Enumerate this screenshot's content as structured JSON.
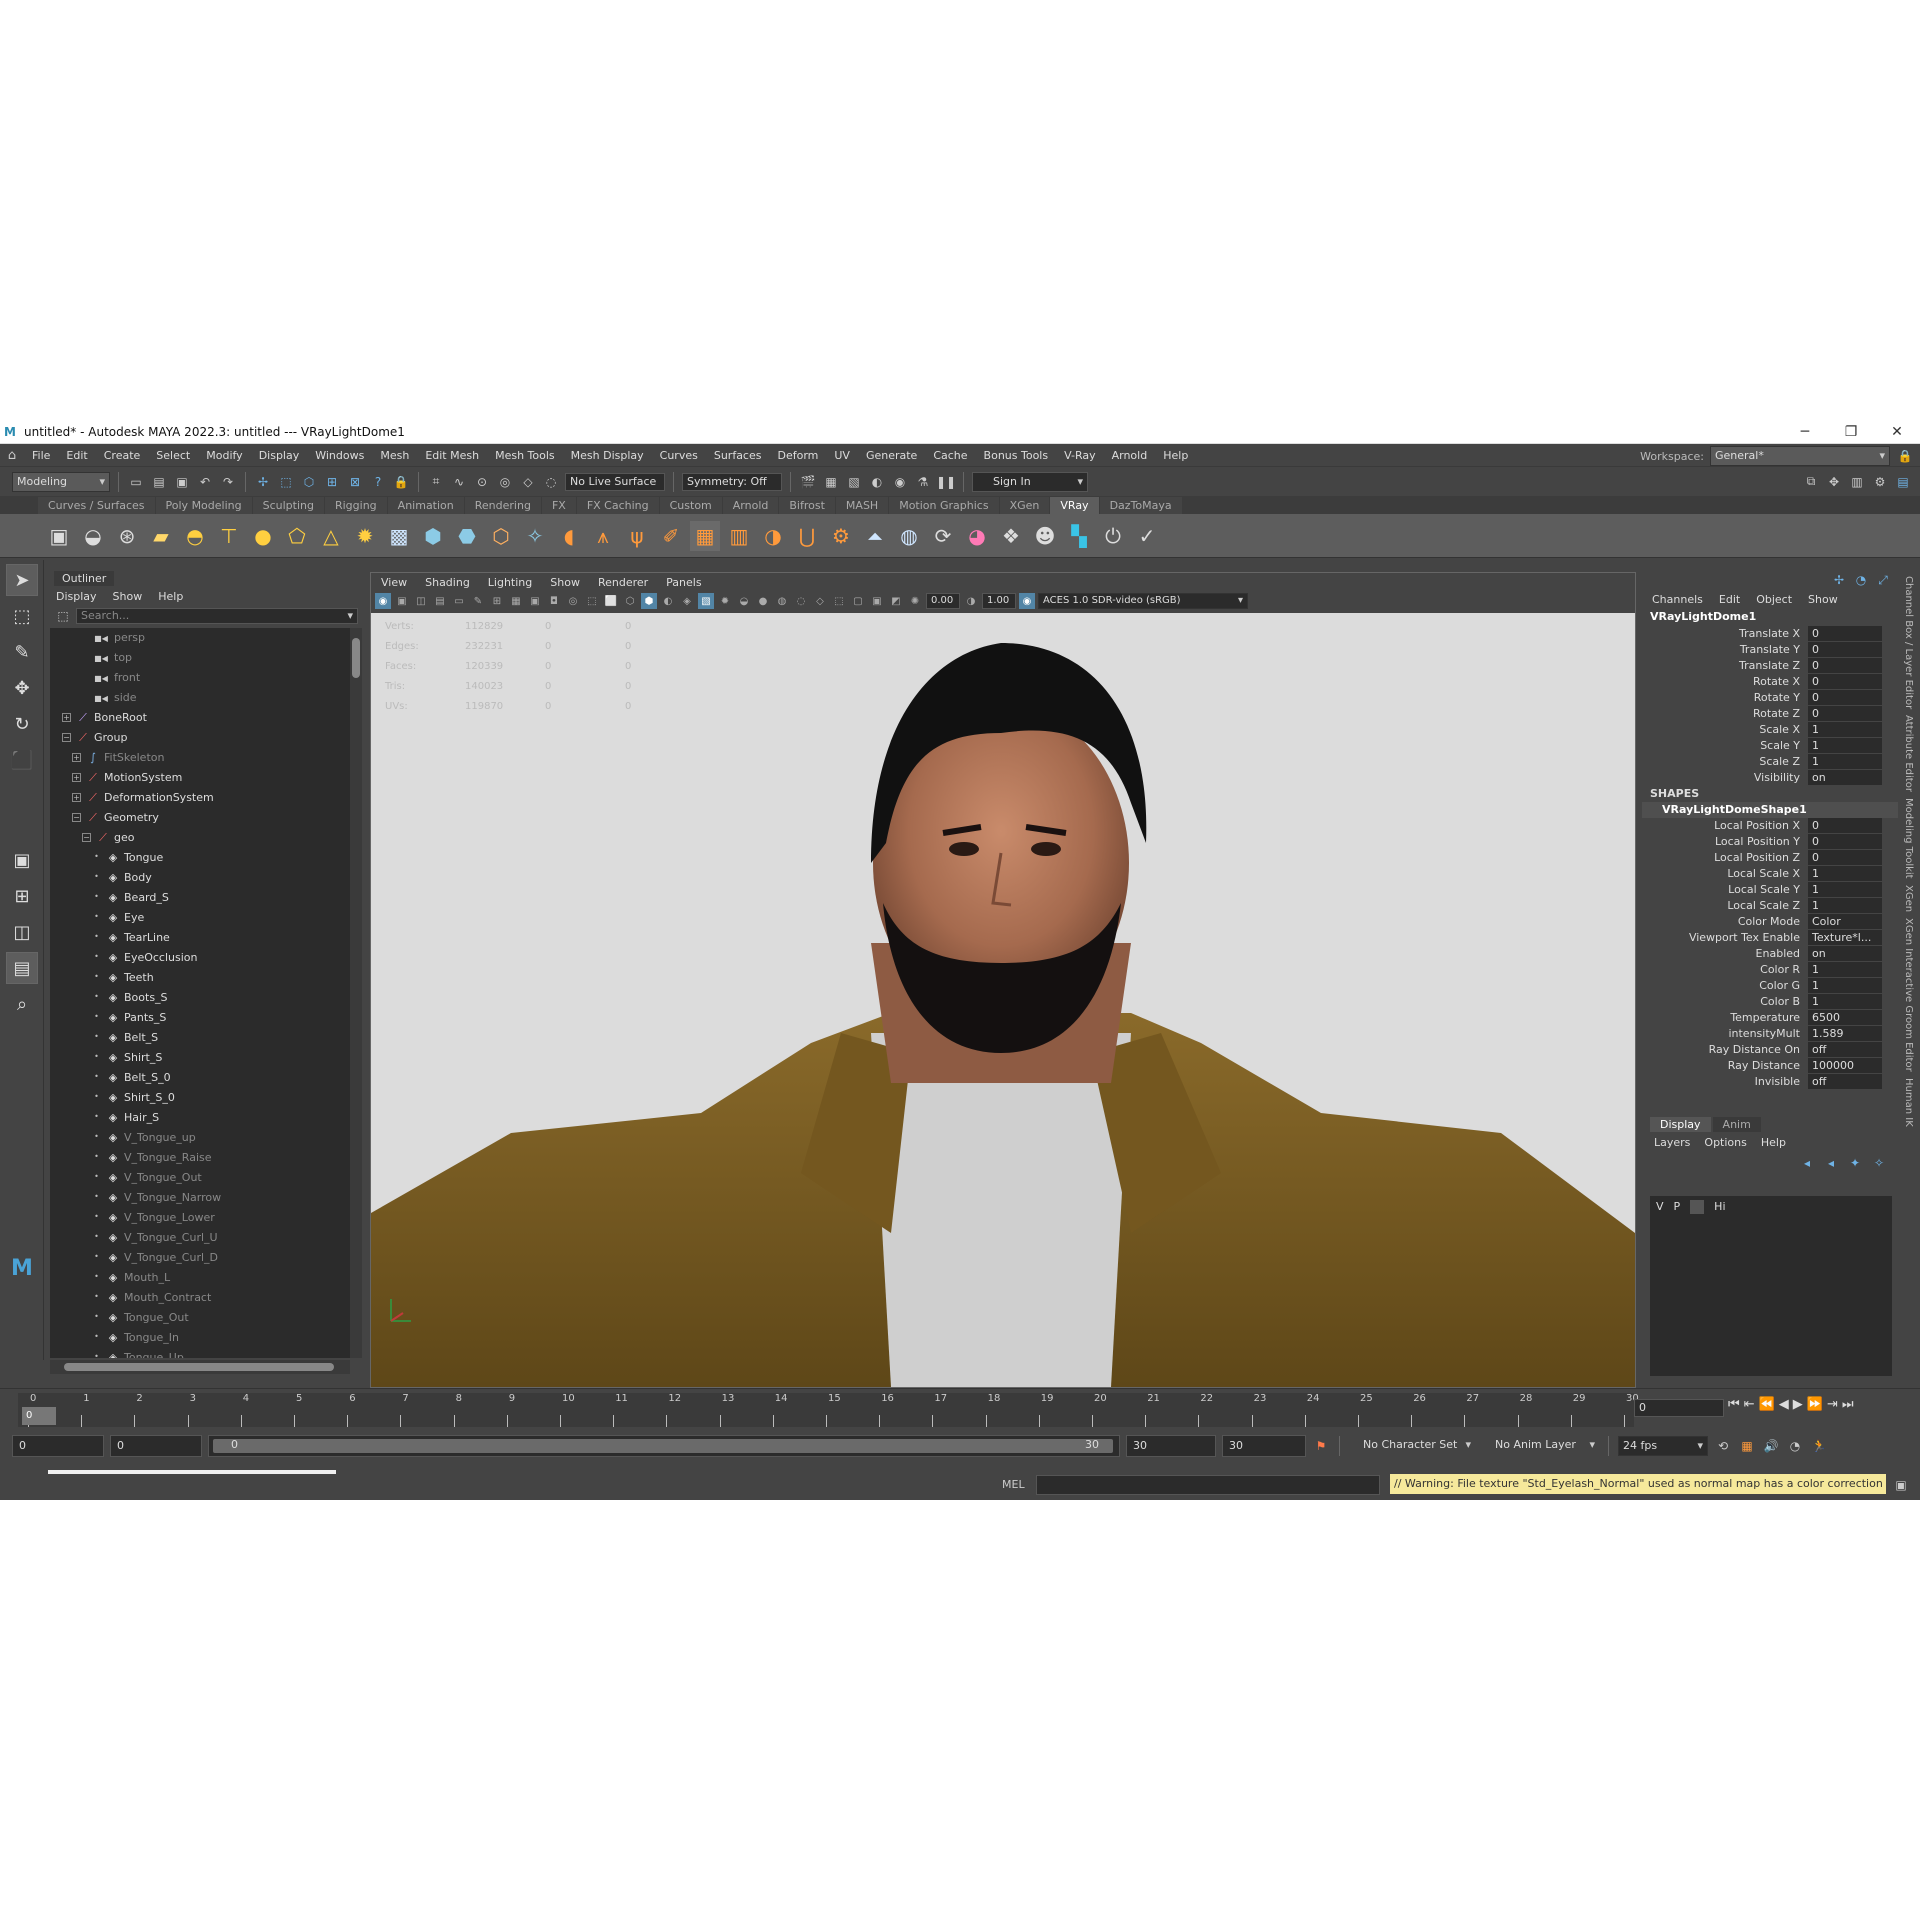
{
  "window": {
    "title": "untitled* - Autodesk MAYA 2022.3: untitled   ---   VRayLightDome1",
    "minimize": "─",
    "restore": "❐",
    "close": "✕"
  },
  "menubar": {
    "items": [
      "File",
      "Edit",
      "Create",
      "Select",
      "Modify",
      "Display",
      "Windows",
      "Mesh",
      "Edit Mesh",
      "Mesh Tools",
      "Mesh Display",
      "Curves",
      "Surfaces",
      "Deform",
      "UV",
      "Generate",
      "Cache",
      "Bonus Tools",
      "V-Ray",
      "Arnold",
      "Help"
    ],
    "workspace_label": "Workspace:",
    "workspace_value": "General*"
  },
  "statusline": {
    "mode": "Modeling",
    "live_surface": "No Live Surface",
    "symmetry": "Symmetry: Off",
    "sign_in": "Sign In"
  },
  "shelf": {
    "tabs": [
      "Curves / Surfaces",
      "Poly Modeling",
      "Sculpting",
      "Rigging",
      "Animation",
      "Rendering",
      "FX",
      "FX Caching",
      "Custom",
      "Arnold",
      "Bifrost",
      "MASH",
      "Motion Graphics",
      "XGen",
      "VRay",
      "DazToMaya"
    ],
    "active_tab": "VRay"
  },
  "outliner": {
    "title": "Outliner",
    "menu": [
      "Display",
      "Show",
      "Help"
    ],
    "search_placeholder": "Search...",
    "items": [
      {
        "label": "persp",
        "depth": 0,
        "dim": true,
        "icon": "camera-icon",
        "expander": ""
      },
      {
        "label": "top",
        "depth": 0,
        "dim": true,
        "icon": "camera-icon",
        "expander": ""
      },
      {
        "label": "front",
        "depth": 0,
        "dim": true,
        "icon": "camera-icon",
        "expander": ""
      },
      {
        "label": "side",
        "depth": 0,
        "dim": true,
        "icon": "camera-icon",
        "expander": ""
      },
      {
        "label": "BoneRoot",
        "depth": 0,
        "dim": false,
        "icon": "joint-icon",
        "expander": "+"
      },
      {
        "label": "Group",
        "depth": 0,
        "dim": false,
        "icon": "transform-icon",
        "expander": "−"
      },
      {
        "label": "FitSkeleton",
        "depth": 1,
        "dim": true,
        "icon": "curve-icon",
        "expander": "+"
      },
      {
        "label": "MotionSystem",
        "depth": 1,
        "dim": false,
        "icon": "transform-icon",
        "expander": "+"
      },
      {
        "label": "DeformationSystem",
        "depth": 1,
        "dim": false,
        "icon": "transform-icon",
        "expander": "+"
      },
      {
        "label": "Geometry",
        "depth": 1,
        "dim": false,
        "icon": "transform-icon",
        "expander": "−"
      },
      {
        "label": "geo",
        "depth": 2,
        "dim": false,
        "icon": "transform-icon",
        "expander": "−"
      },
      {
        "label": "Tongue",
        "depth": 3,
        "dim": false,
        "icon": "mesh-icon",
        "expander": "•"
      },
      {
        "label": "Body",
        "depth": 3,
        "dim": false,
        "icon": "mesh-icon",
        "expander": "•"
      },
      {
        "label": "Beard_S",
        "depth": 3,
        "dim": false,
        "icon": "mesh-icon",
        "expander": "•"
      },
      {
        "label": "Eye",
        "depth": 3,
        "dim": false,
        "icon": "mesh-icon",
        "expander": "•"
      },
      {
        "label": "TearLine",
        "depth": 3,
        "dim": false,
        "icon": "mesh-icon",
        "expander": "•"
      },
      {
        "label": "EyeOcclusion",
        "depth": 3,
        "dim": false,
        "icon": "mesh-icon",
        "expander": "•"
      },
      {
        "label": "Teeth",
        "depth": 3,
        "dim": false,
        "icon": "mesh-icon",
        "expander": "•"
      },
      {
        "label": "Boots_S",
        "depth": 3,
        "dim": false,
        "icon": "mesh-icon",
        "expander": "•"
      },
      {
        "label": "Pants_S",
        "depth": 3,
        "dim": false,
        "icon": "mesh-icon",
        "expander": "•"
      },
      {
        "label": "Belt_S",
        "depth": 3,
        "dim": false,
        "icon": "mesh-icon",
        "expander": "•"
      },
      {
        "label": "Shirt_S",
        "depth": 3,
        "dim": false,
        "icon": "mesh-icon",
        "expander": "•"
      },
      {
        "label": "Belt_S_0",
        "depth": 3,
        "dim": false,
        "icon": "mesh-icon",
        "expander": "•"
      },
      {
        "label": "Shirt_S_0",
        "depth": 3,
        "dim": false,
        "icon": "mesh-icon",
        "expander": "•"
      },
      {
        "label": "Hair_S",
        "depth": 3,
        "dim": false,
        "icon": "mesh-icon",
        "expander": "•"
      },
      {
        "label": "V_Tongue_up",
        "depth": 3,
        "dim": true,
        "icon": "mesh-icon",
        "expander": "•"
      },
      {
        "label": "V_Tongue_Raise",
        "depth": 3,
        "dim": true,
        "icon": "mesh-icon",
        "expander": "•"
      },
      {
        "label": "V_Tongue_Out",
        "depth": 3,
        "dim": true,
        "icon": "mesh-icon",
        "expander": "•"
      },
      {
        "label": "V_Tongue_Narrow",
        "depth": 3,
        "dim": true,
        "icon": "mesh-icon",
        "expander": "•"
      },
      {
        "label": "V_Tongue_Lower",
        "depth": 3,
        "dim": true,
        "icon": "mesh-icon",
        "expander": "•"
      },
      {
        "label": "V_Tongue_Curl_U",
        "depth": 3,
        "dim": true,
        "icon": "mesh-icon",
        "expander": "•"
      },
      {
        "label": "V_Tongue_Curl_D",
        "depth": 3,
        "dim": true,
        "icon": "mesh-icon",
        "expander": "•"
      },
      {
        "label": "Mouth_L",
        "depth": 3,
        "dim": true,
        "icon": "mesh-icon",
        "expander": "•"
      },
      {
        "label": "Mouth_Contract",
        "depth": 3,
        "dim": true,
        "icon": "mesh-icon",
        "expander": "•"
      },
      {
        "label": "Tongue_Out",
        "depth": 3,
        "dim": true,
        "icon": "mesh-icon",
        "expander": "•"
      },
      {
        "label": "Tongue_In",
        "depth": 3,
        "dim": true,
        "icon": "mesh-icon",
        "expander": "•"
      },
      {
        "label": "Tongue_Up",
        "depth": 3,
        "dim": true,
        "icon": "mesh-icon",
        "expander": "•"
      }
    ]
  },
  "viewport": {
    "menu": [
      "View",
      "Shading",
      "Lighting",
      "Show",
      "Renderer",
      "Panels"
    ],
    "exposure": "0.00",
    "gamma": "1.00",
    "color_space": "ACES 1.0 SDR-video (sRGB)",
    "hud": [
      {
        "label": "Verts:",
        "v1": "112829",
        "v2": "0",
        "v3": "0"
      },
      {
        "label": "Edges:",
        "v1": "232231",
        "v2": "0",
        "v3": "0"
      },
      {
        "label": "Faces:",
        "v1": "120339",
        "v2": "0",
        "v3": "0"
      },
      {
        "label": "Tris:",
        "v1": "140023",
        "v2": "0",
        "v3": "0"
      },
      {
        "label": "UVs:",
        "v1": "119870",
        "v2": "0",
        "v3": "0"
      }
    ]
  },
  "channelbox": {
    "menu": [
      "Channels",
      "Edit",
      "Object",
      "Show"
    ],
    "object": "VRayLightDome1",
    "transform": [
      {
        "name": "Translate X",
        "value": "0"
      },
      {
        "name": "Translate Y",
        "value": "0"
      },
      {
        "name": "Translate Z",
        "value": "0"
      },
      {
        "name": "Rotate X",
        "value": "0"
      },
      {
        "name": "Rotate Y",
        "value": "0"
      },
      {
        "name": "Rotate Z",
        "value": "0"
      },
      {
        "name": "Scale X",
        "value": "1"
      },
      {
        "name": "Scale Y",
        "value": "1"
      },
      {
        "name": "Scale Z",
        "value": "1"
      },
      {
        "name": "Visibility",
        "value": "on"
      }
    ],
    "shapes_label": "SHAPES",
    "shape": "VRayLightDomeShape1",
    "shape_attrs": [
      {
        "name": "Local Position X",
        "value": "0"
      },
      {
        "name": "Local Position Y",
        "value": "0"
      },
      {
        "name": "Local Position Z",
        "value": "0"
      },
      {
        "name": "Local Scale X",
        "value": "1"
      },
      {
        "name": "Local Scale Y",
        "value": "1"
      },
      {
        "name": "Local Scale Z",
        "value": "1"
      },
      {
        "name": "Color Mode",
        "value": "Color"
      },
      {
        "name": "Viewport Tex Enable",
        "value": "Texture*l..."
      },
      {
        "name": "Enabled",
        "value": "on"
      },
      {
        "name": "Color R",
        "value": "1"
      },
      {
        "name": "Color G",
        "value": "1"
      },
      {
        "name": "Color B",
        "value": "1"
      },
      {
        "name": "Temperature",
        "value": "6500"
      },
      {
        "name": "intensityMult",
        "value": "1.589"
      },
      {
        "name": "Ray Distance On",
        "value": "off"
      },
      {
        "name": "Ray Distance",
        "value": "100000"
      },
      {
        "name": "Invisible",
        "value": "off"
      }
    ]
  },
  "layereditor": {
    "tabs": [
      "Display",
      "Anim"
    ],
    "menu": [
      "Layers",
      "Options",
      "Help"
    ],
    "row": {
      "v": "V",
      "p": "P",
      "name": "Hi"
    }
  },
  "sidetabs": [
    "Channel Box / Layer Editor",
    "Attribute Editor",
    "Modeling Toolkit",
    "XGen",
    "XGen Interactive Groom Editor",
    "Human IK"
  ],
  "timeline": {
    "ticks": [
      "0",
      "1",
      "2",
      "3",
      "4",
      "5",
      "6",
      "7",
      "8",
      "9",
      "10",
      "11",
      "12",
      "13",
      "14",
      "15",
      "16",
      "17",
      "18",
      "19",
      "20",
      "21",
      "22",
      "23",
      "24",
      "25",
      "26",
      "27",
      "28",
      "29",
      "30"
    ],
    "current_marker": "0",
    "current_frame": "0",
    "range_start": "0",
    "playback_start": "0",
    "range_inner_start": "0",
    "range_inner_end": "30",
    "playback_end": "30",
    "range_end": "30",
    "character_set": "No Character Set",
    "anim_layer": "No Anim Layer",
    "fps": "24 fps"
  },
  "commandline": {
    "lang": "MEL",
    "warning": "// Warning: File texture \"Std_Eyelash_Normal\" used as normal map has a color correction enable"
  },
  "colors": {
    "panel": "#444444",
    "field": "#2b2b2b",
    "shelf": "#5d5d5d",
    "warning_bg": "#f6e99b",
    "accent": "#5285a6"
  }
}
